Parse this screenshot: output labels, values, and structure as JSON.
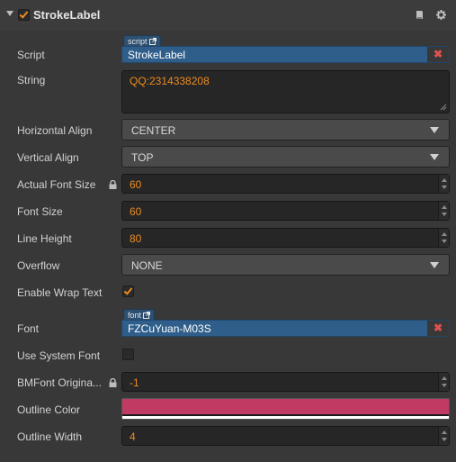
{
  "component": {
    "title": "StrokeLabel",
    "enabled": true
  },
  "properties": {
    "script": {
      "label": "Script",
      "tag": "script",
      "value": "StrokeLabel"
    },
    "string": {
      "label": "String",
      "value": "QQ:2314338208"
    },
    "horizontal_align": {
      "label": "Horizontal Align",
      "value": "CENTER"
    },
    "vertical_align": {
      "label": "Vertical Align",
      "value": "TOP"
    },
    "actual_font_size": {
      "label": "Actual Font Size",
      "value": "60",
      "locked": true
    },
    "font_size": {
      "label": "Font Size",
      "value": "60"
    },
    "line_height": {
      "label": "Line Height",
      "value": "80"
    },
    "overflow": {
      "label": "Overflow",
      "value": "NONE"
    },
    "enable_wrap_text": {
      "label": "Enable Wrap Text",
      "checked": true
    },
    "font": {
      "label": "Font",
      "tag": "font",
      "value": "FZCuYuan-M03S"
    },
    "use_system_font": {
      "label": "Use System Font",
      "checked": false
    },
    "bmfont_original_size": {
      "label": "BMFont Origina...",
      "value": "-1",
      "locked": true
    },
    "outline_color": {
      "label": "Outline Color",
      "color": "#c03a63"
    },
    "outline_width": {
      "label": "Outline Width",
      "value": "4"
    }
  },
  "icons": [
    "fold-arrow-icon",
    "checkbox-icon",
    "book-icon",
    "gear-icon",
    "lock-icon",
    "external-link-icon",
    "clear-icon",
    "dropdown-caret-icon",
    "spinner-icon",
    "resize-grip-icon"
  ],
  "colors": {
    "accent": "#ec8b23",
    "asset_field": "#2f5e8a",
    "asset_tag": "#2d4f70",
    "clear": "#e05050",
    "background": "#383838"
  }
}
